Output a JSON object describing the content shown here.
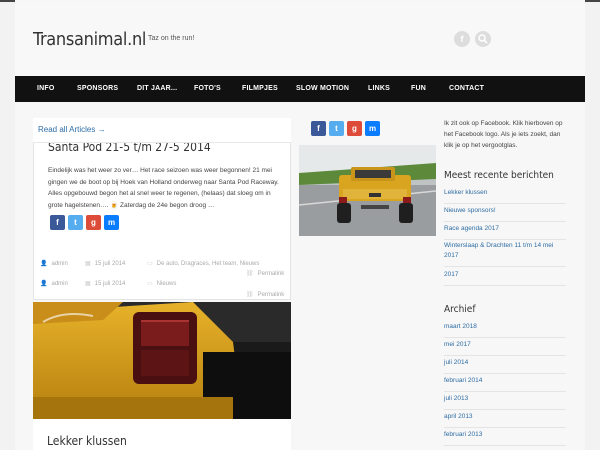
{
  "header": {
    "site_title": "Transanimal.nl",
    "tagline": "Taz on the run!",
    "icons": [
      "facebook-icon",
      "search-icon"
    ]
  },
  "nav": {
    "items": [
      {
        "label": "INFO"
      },
      {
        "label": "SPONSORS"
      },
      {
        "label": "DIT JAAR..."
      },
      {
        "label": "FOTO'S"
      },
      {
        "label": "FILMPJES"
      },
      {
        "label": "SLOW MOTION"
      },
      {
        "label": "LINKS"
      },
      {
        "label": "FUN"
      },
      {
        "label": "CONTACT"
      }
    ]
  },
  "main": {
    "read_all": "Read all Articles →",
    "post1": {
      "title": "Santa Pod 21-5 t/m 27-5 2014",
      "excerpt": "Eindelijk was het weer zo ver… Het race seizoen was weer begonnen! 21 mei gingen we de boot op bij Hoek van Holland onderweg naar Santa Pod Raceway. Alles opgebouwd begon het al snel weer te regenen, (helaas) dat sloeg om in grote hagelstenen…. 🍺 Zaterdag de 24e begon droog …",
      "author": "admin",
      "date": "15 juli 2014",
      "categories": "De auto, Dragraces, Het team, Nieuws",
      "permalink": "Permalink",
      "author2": "admin",
      "date2": "15 juli 2014",
      "categories2": "Nieuws",
      "permalink2": "Permalink"
    },
    "post2": {
      "title": "Lekker klussen"
    }
  },
  "sidebar": {
    "facebook_text": "Ik zit ook op Facebook. Klik hierboven op het Facebook logo. Als je iets zoekt, dan klik je op het vergootglas.",
    "recent_title": "Meest recente berichten",
    "recent": [
      "Lekker klussen",
      "Nieuwe sponsors!",
      "Race agenda 2017",
      "Winterslaap & Drachten 11 t/m 14 mei 2017",
      "2017"
    ],
    "archive_title": "Archief",
    "archive": [
      "maart 2018",
      "mei 2017",
      "juli 2014",
      "februari 2014",
      "juli 2013",
      "april 2013",
      "februari 2013"
    ]
  },
  "colors": {
    "nav_bg": "#111111",
    "link": "#2e6da4",
    "facebook": "#3b5998",
    "twitter": "#55acee",
    "google": "#dd4b39",
    "messenger": "#0a7cff"
  }
}
